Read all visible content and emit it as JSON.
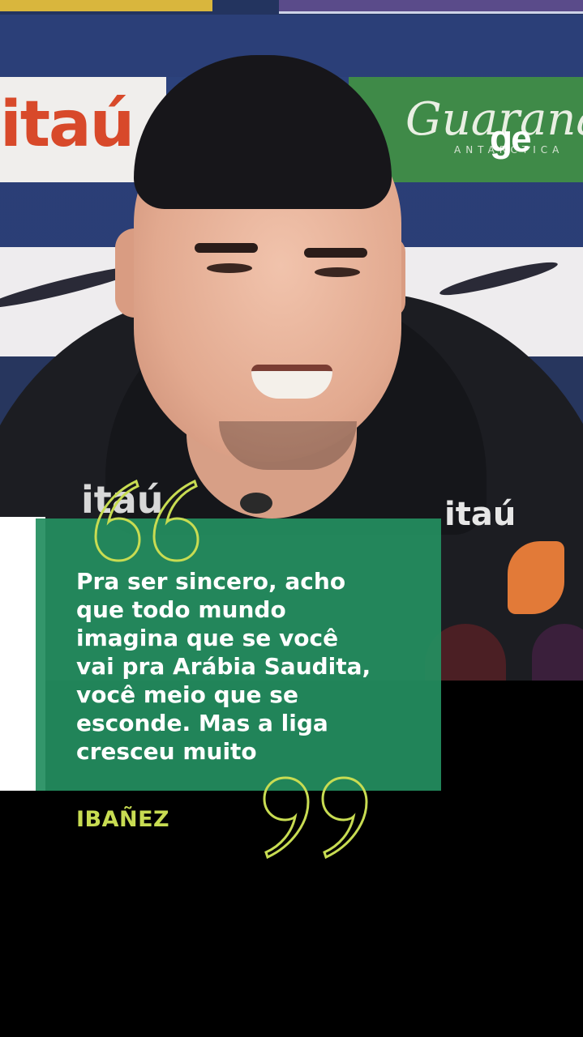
{
  "brand": {
    "logo_text": "ge"
  },
  "backdrop": {
    "sponsor_1": "itaú",
    "sponsor_2": "Guaraná",
    "sponsor_2_sub": "ANTARCTICA",
    "chest_logo": "itaú"
  },
  "quote": {
    "lines": [
      "Pra ser sincero, acho",
      "que todo mundo",
      "imagina que se você",
      "vai pra Arábia Saudita,",
      "você meio que se",
      "esconde. Mas a liga",
      "cresceu muito"
    ],
    "author": "IBAÑEZ"
  },
  "colors": {
    "quote_card": "#248e60",
    "quote_marks": "#c8dc52",
    "author": "#c8dc52",
    "background": "#000000"
  },
  "icons": {
    "open_quote": "open-quote-icon",
    "close_quote": "close-quote-icon"
  }
}
